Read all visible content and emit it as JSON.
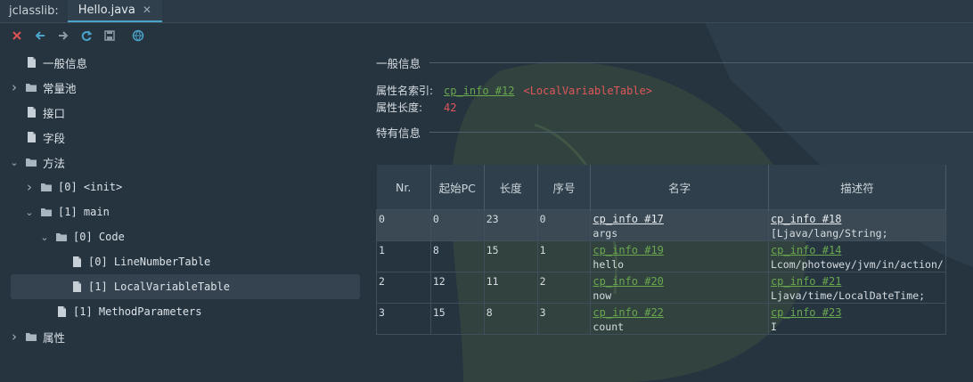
{
  "app_title": "jclasslib:",
  "tab": {
    "label": "Hello.java",
    "close": "✕"
  },
  "toolbar": [
    {
      "name": "close-icon",
      "color": "#e05252"
    },
    {
      "name": "back-icon",
      "color": "#4aa3c9"
    },
    {
      "name": "forward-icon",
      "color": "#8a98a3"
    },
    {
      "name": "refresh-icon",
      "color": "#4aa3c9"
    },
    {
      "name": "save-icon",
      "color": "#8a98a3"
    },
    {
      "name": "browser-icon",
      "color": "#4aa3c9"
    }
  ],
  "tree": [
    {
      "label": "一般信息",
      "level": 0,
      "kind": "file",
      "expanded": null
    },
    {
      "label": "常量池",
      "level": 0,
      "kind": "folder",
      "expanded": false
    },
    {
      "label": "接口",
      "level": 0,
      "kind": "file",
      "expanded": null
    },
    {
      "label": "字段",
      "level": 0,
      "kind": "file",
      "expanded": null
    },
    {
      "label": "方法",
      "level": 0,
      "kind": "folder",
      "expanded": true
    },
    {
      "label": "[0] <init>",
      "level": 1,
      "kind": "folder",
      "expanded": false
    },
    {
      "label": "[1] main",
      "level": 1,
      "kind": "folder",
      "expanded": true
    },
    {
      "label": "[0] Code",
      "level": 2,
      "kind": "folder",
      "expanded": true
    },
    {
      "label": "[0] LineNumberTable",
      "level": 3,
      "kind": "file",
      "expanded": null
    },
    {
      "label": "[1] LocalVariableTable",
      "level": 3,
      "kind": "file",
      "expanded": null,
      "selected": true
    },
    {
      "label": "[1] MethodParameters",
      "level": 2,
      "kind": "file",
      "expanded": null
    },
    {
      "label": "属性",
      "level": 0,
      "kind": "folder",
      "expanded": false
    }
  ],
  "general": {
    "title": "一般信息",
    "name_index_label": "属性名索引:",
    "name_index_link": "cp_info #12",
    "name_index_value": "<LocalVariableTable>",
    "length_label": "属性长度:",
    "length_value": "42"
  },
  "specific": {
    "title": "特有信息"
  },
  "table": {
    "headers": [
      "Nr.",
      "起始PC",
      "长度",
      "序号",
      "名字",
      "描述符"
    ],
    "rows": [
      {
        "nr": "0",
        "pc": "0",
        "len": "23",
        "idx": "0",
        "name_link": "cp_info #17",
        "name": "args",
        "desc_link": "cp_info #18",
        "desc": "[Ljava/lang/String;",
        "selected": true
      },
      {
        "nr": "1",
        "pc": "8",
        "len": "15",
        "idx": "1",
        "name_link": "cp_info #19",
        "name": "hello",
        "desc_link": "cp_info #14",
        "desc": "Lcom/photowey/jvm/in/action/"
      },
      {
        "nr": "2",
        "pc": "12",
        "len": "11",
        "idx": "2",
        "name_link": "cp_info #20",
        "name": "now",
        "desc_link": "cp_info #21",
        "desc": "Ljava/time/LocalDateTime;"
      },
      {
        "nr": "3",
        "pc": "15",
        "len": "8",
        "idx": "3",
        "name_link": "cp_info #22",
        "name": "count",
        "desc_link": "cp_info #23",
        "desc": "I"
      }
    ]
  }
}
